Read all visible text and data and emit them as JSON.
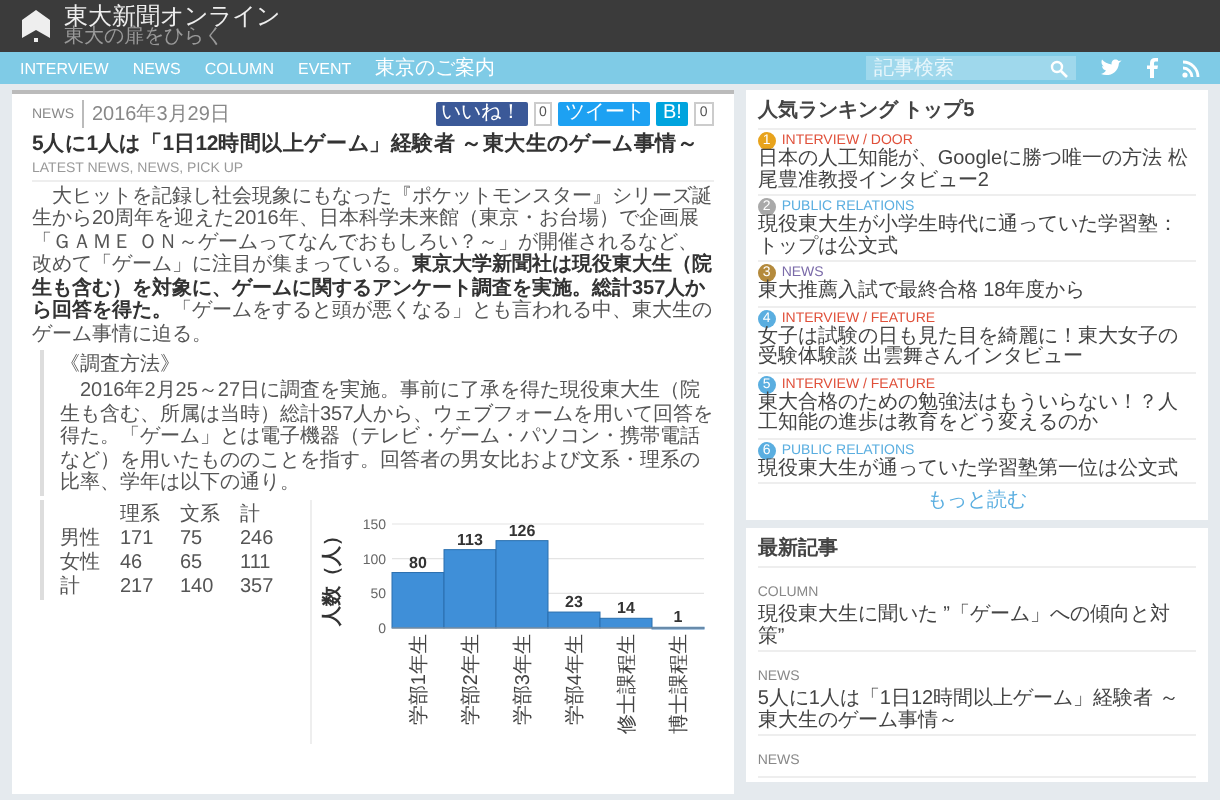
{
  "header": {
    "site_title": "東大新聞オンライン",
    "tagline": "東大の扉をひらく"
  },
  "nav": {
    "items": [
      {
        "label": "INTERVIEW"
      },
      {
        "label": "NEWS"
      },
      {
        "label": "COLUMN"
      },
      {
        "label": "EVENT"
      },
      {
        "label": "東京のご案内"
      }
    ],
    "search": {
      "placeholder": "記事検索"
    }
  },
  "article": {
    "category": "NEWS",
    "date": "2016年3月29日",
    "share": [
      {
        "kind": "facebook",
        "label": "いいね！",
        "count": "0"
      },
      {
        "kind": "twitter",
        "label": "ツイート"
      },
      {
        "kind": "hatena",
        "label": "B!",
        "count": "0"
      }
    ],
    "title": "5人に1人は「1日12時間以上ゲーム」経験者 ～東大生のゲーム事情～",
    "tags": "LATEST NEWS, NEWS, PICK UP",
    "lead": "大ヒットを記録し社会現象にもなった『ポケットモンスター』シリーズ誕生から20周年を迎えた2016年、日本科学未来館（東京・お台場）で企画展「ＧＡＭＥ ＯＮ～ゲームってなんでおもしろい？～」が開催されるなど、改めて「ゲーム」に注目が集まっている。**東京大学新聞社は現役東大生（院生も含む）を対象に、ゲームに関するアンケート調査を実施。総計357人から回答を得た。**「ゲームをすると頭が悪くなる」とも言われる中、東大生のゲーム事情に迫る。",
    "method_heading": "《調査方法》",
    "method_text": "2016年2月25～27日に調査を実施。事前に了承を得た現役東大生（院生も含む、所属は当時）総計357人から、ウェブフォームを用いて回答を得た。「ゲーム」とは電子機器（テレビ・ゲーム・パソコン・携帯電話など）を用いたもののことを指す。回答者の男女比および文系・理系の比率、学年は以下の通り。",
    "table": {
      "columns": [
        "",
        "理系",
        "文系",
        "計"
      ],
      "rows": [
        [
          "男性",
          "171",
          "75",
          "246"
        ],
        [
          "女性",
          "46",
          "65",
          "111"
        ],
        [
          "計",
          "217",
          "140",
          "357"
        ]
      ]
    },
    "chart_data": {
      "type": "bar",
      "ylabel": "人数（人）",
      "categories": [
        "学部1年生",
        "学部2年生",
        "学部3年生",
        "学部4年生",
        "修士課程生",
        "博士課程生"
      ],
      "values": [
        80,
        113,
        126,
        23,
        14,
        1
      ],
      "ylim": [
        0,
        150
      ],
      "yticks": [
        0,
        50,
        100,
        150
      ],
      "data_labels": true
    }
  },
  "sidebar": {
    "ranking": {
      "title": "人気ランキング トップ5",
      "items": [
        {
          "rank": "1",
          "color": "#e8a31c",
          "kind": "interview",
          "category": "INTERVIEW / DOOR",
          "title": "日本の人工知能が、Googleに勝つ唯一の方法 松尾豊准教授インタビュー2"
        },
        {
          "rank": "2",
          "color": "#a9a9a9",
          "kind": "pr",
          "category": "PUBLIC RELATIONS",
          "title": "現役東大生が小学生時代に通っていた学習塾：トップは公文式"
        },
        {
          "rank": "3",
          "color": "#b48a3c",
          "kind": "news",
          "category": "NEWS",
          "title": "東大推薦入試で最終合格 18年度から"
        },
        {
          "rank": "4",
          "color": "#5aaee0",
          "kind": "interview",
          "category": "INTERVIEW / FEATURE",
          "title": "女子は試験の日も見た目を綺麗に！東大女子の受験体験談 出雲舞さんインタビュー"
        },
        {
          "rank": "5",
          "color": "#5aaee0",
          "kind": "interview",
          "category": "INTERVIEW / FEATURE",
          "title": "東大合格のための勉強法はもういらない！？人工知能の進歩は教育をどう変えるのか"
        },
        {
          "rank": "6",
          "color": "#5aaee0",
          "kind": "pr",
          "category": "PUBLIC RELATIONS",
          "title": "現役東大生が通っていた学習塾第一位は公文式"
        }
      ],
      "more": "もっと読む"
    },
    "latest": {
      "title": "最新記事",
      "items": [
        {
          "category": "COLUMN",
          "title": "現役東大生に聞いた ”「ゲーム」への傾向と対策”"
        },
        {
          "category": "NEWS",
          "title": "5人に1人は「1日12時間以上ゲーム」経験者 ～東大生のゲーム事情～"
        },
        {
          "category": "NEWS"
        }
      ]
    }
  }
}
